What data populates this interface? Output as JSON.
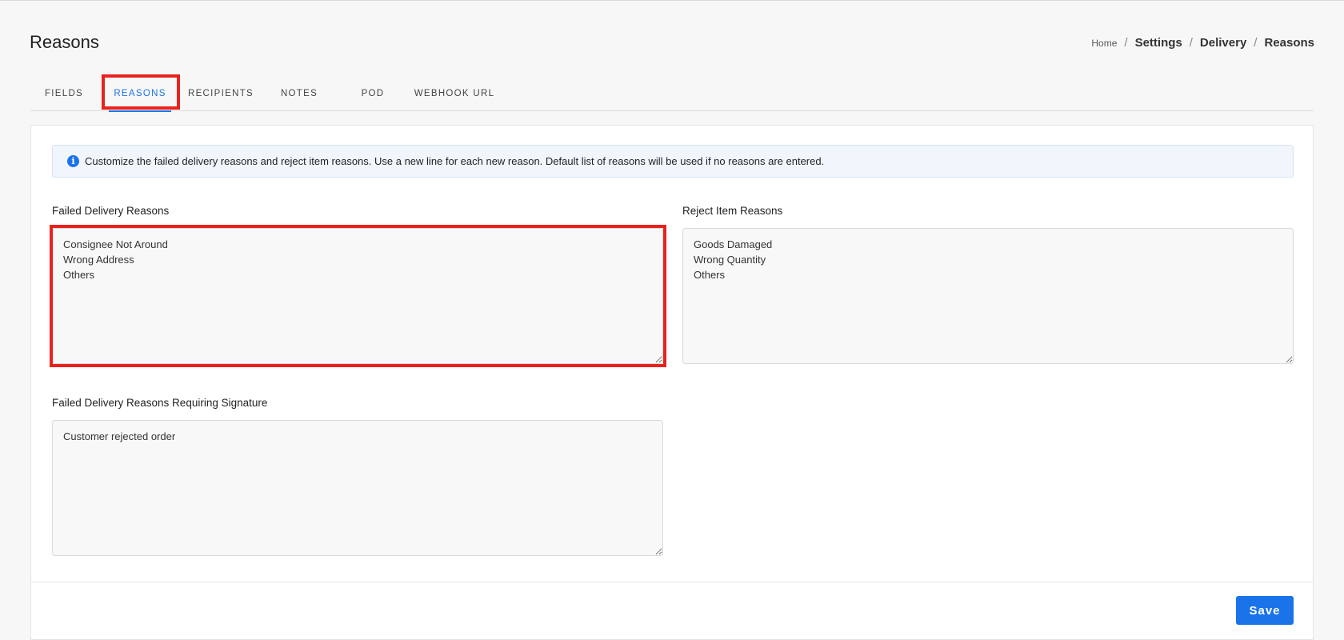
{
  "page": {
    "title": "Reasons"
  },
  "breadcrumb": {
    "home": "Home",
    "settings": "Settings",
    "delivery": "Delivery",
    "current": "Reasons",
    "separator": "/"
  },
  "tabs": [
    {
      "label": "FIELDS",
      "active": false
    },
    {
      "label": "REASONS",
      "active": true
    },
    {
      "label": "RECIPIENTS",
      "active": false
    },
    {
      "label": "NOTES",
      "active": false
    },
    {
      "label": "POD",
      "active": false
    },
    {
      "label": "WEBHOOK URL",
      "active": false
    }
  ],
  "alert": {
    "icon": "info-icon",
    "text": "Customize the failed delivery reasons and reject item reasons. Use a new line for each new reason. Default list of reasons will be used if no reasons are entered."
  },
  "fields": {
    "failed_delivery": {
      "label": "Failed Delivery Reasons",
      "value": "Consignee Not Around\nWrong Address\nOthers"
    },
    "reject_item": {
      "label": "Reject Item Reasons",
      "value": "Goods Damaged\nWrong Quantity\nOthers"
    },
    "requiring_signature": {
      "label": "Failed Delivery Reasons Requiring Signature",
      "value": "Customer rejected order"
    }
  },
  "actions": {
    "save_label": "Save"
  },
  "colors": {
    "accent": "#1a73e8",
    "highlight": "#e8231d"
  }
}
